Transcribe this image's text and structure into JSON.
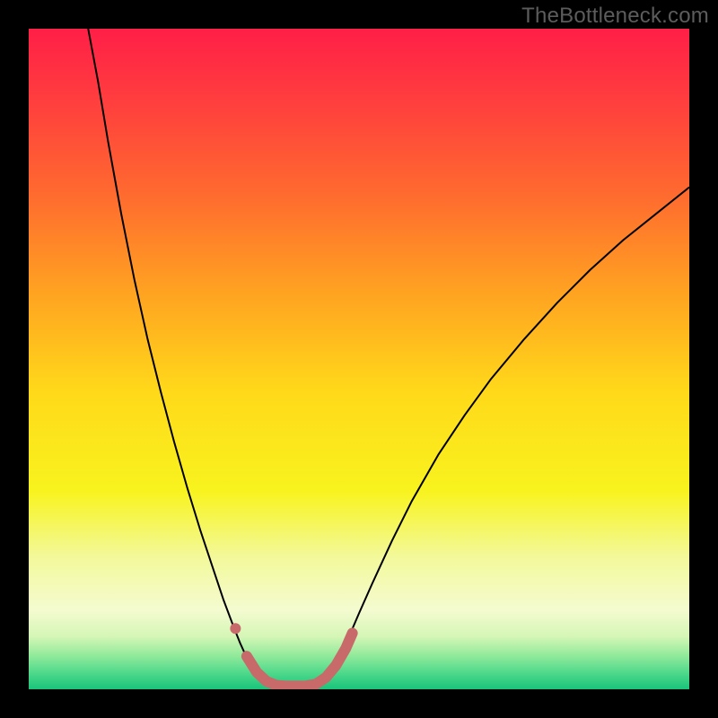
{
  "watermark": "TheBottleneck.com",
  "chart_data": {
    "type": "line",
    "title": "",
    "xlabel": "",
    "ylabel": "",
    "xlim": [
      0,
      100
    ],
    "ylim": [
      0,
      100
    ],
    "background_gradient": {
      "stops": [
        {
          "offset": 0.0,
          "color": "#ff1f47"
        },
        {
          "offset": 0.1,
          "color": "#ff3b3f"
        },
        {
          "offset": 0.25,
          "color": "#ff6a2f"
        },
        {
          "offset": 0.4,
          "color": "#ffa321"
        },
        {
          "offset": 0.55,
          "color": "#ffd91a"
        },
        {
          "offset": 0.7,
          "color": "#f8f31e"
        },
        {
          "offset": 0.8,
          "color": "#f3f99a"
        },
        {
          "offset": 0.88,
          "color": "#f4fbd0"
        },
        {
          "offset": 0.92,
          "color": "#d5f6b6"
        },
        {
          "offset": 0.95,
          "color": "#8fe99a"
        },
        {
          "offset": 0.975,
          "color": "#4fd98c"
        },
        {
          "offset": 1.0,
          "color": "#18c47a"
        }
      ]
    },
    "series": [
      {
        "name": "curve-left",
        "stroke": "#000000",
        "width": 2,
        "points": [
          {
            "x": 9.0,
            "y": 100.0
          },
          {
            "x": 10.5,
            "y": 92.0
          },
          {
            "x": 12.0,
            "y": 83.0
          },
          {
            "x": 14.0,
            "y": 72.0
          },
          {
            "x": 16.0,
            "y": 62.0
          },
          {
            "x": 18.0,
            "y": 53.0
          },
          {
            "x": 20.0,
            "y": 45.0
          },
          {
            "x": 22.0,
            "y": 37.5
          },
          {
            "x": 24.0,
            "y": 30.5
          },
          {
            "x": 26.0,
            "y": 24.0
          },
          {
            "x": 28.0,
            "y": 18.0
          },
          {
            "x": 29.5,
            "y": 13.5
          },
          {
            "x": 31.0,
            "y": 9.5
          },
          {
            "x": 32.0,
            "y": 7.0
          },
          {
            "x": 33.0,
            "y": 4.8
          },
          {
            "x": 34.0,
            "y": 3.0
          },
          {
            "x": 35.0,
            "y": 1.6
          },
          {
            "x": 36.0,
            "y": 0.8
          },
          {
            "x": 37.0,
            "y": 0.3
          },
          {
            "x": 38.0,
            "y": 0.1
          },
          {
            "x": 39.0,
            "y": 0.1
          },
          {
            "x": 40.0,
            "y": 0.1
          },
          {
            "x": 41.0,
            "y": 0.1
          },
          {
            "x": 42.0,
            "y": 0.1
          },
          {
            "x": 43.0,
            "y": 0.3
          },
          {
            "x": 44.0,
            "y": 0.8
          },
          {
            "x": 45.0,
            "y": 1.8
          },
          {
            "x": 46.0,
            "y": 3.2
          },
          {
            "x": 47.0,
            "y": 5.0
          },
          {
            "x": 48.5,
            "y": 8.0
          },
          {
            "x": 50.0,
            "y": 11.5
          },
          {
            "x": 52.0,
            "y": 16.0
          },
          {
            "x": 55.0,
            "y": 22.5
          },
          {
            "x": 58.0,
            "y": 28.5
          },
          {
            "x": 62.0,
            "y": 35.5
          },
          {
            "x": 66.0,
            "y": 41.5
          },
          {
            "x": 70.0,
            "y": 47.0
          },
          {
            "x": 75.0,
            "y": 53.0
          },
          {
            "x": 80.0,
            "y": 58.5
          },
          {
            "x": 85.0,
            "y": 63.5
          },
          {
            "x": 90.0,
            "y": 68.0
          },
          {
            "x": 95.0,
            "y": 72.0
          },
          {
            "x": 100.0,
            "y": 76.0
          }
        ]
      },
      {
        "name": "highlight-band",
        "stroke": "#c86a6a",
        "width": 12,
        "linecap": "round",
        "points": [
          {
            "x": 33.0,
            "y": 5.0
          },
          {
            "x": 34.5,
            "y": 2.6
          },
          {
            "x": 36.0,
            "y": 1.2
          },
          {
            "x": 37.5,
            "y": 0.6
          },
          {
            "x": 39.0,
            "y": 0.5
          },
          {
            "x": 40.5,
            "y": 0.5
          },
          {
            "x": 42.0,
            "y": 0.5
          },
          {
            "x": 43.5,
            "y": 0.8
          },
          {
            "x": 45.0,
            "y": 1.8
          },
          {
            "x": 46.5,
            "y": 3.6
          },
          {
            "x": 48.0,
            "y": 6.2
          },
          {
            "x": 49.0,
            "y": 8.5
          }
        ]
      },
      {
        "name": "highlight-dot",
        "stroke": "#c86a6a",
        "type_hint": "marker",
        "radius": 6,
        "points": [
          {
            "x": 31.3,
            "y": 9.2
          }
        ]
      }
    ]
  }
}
